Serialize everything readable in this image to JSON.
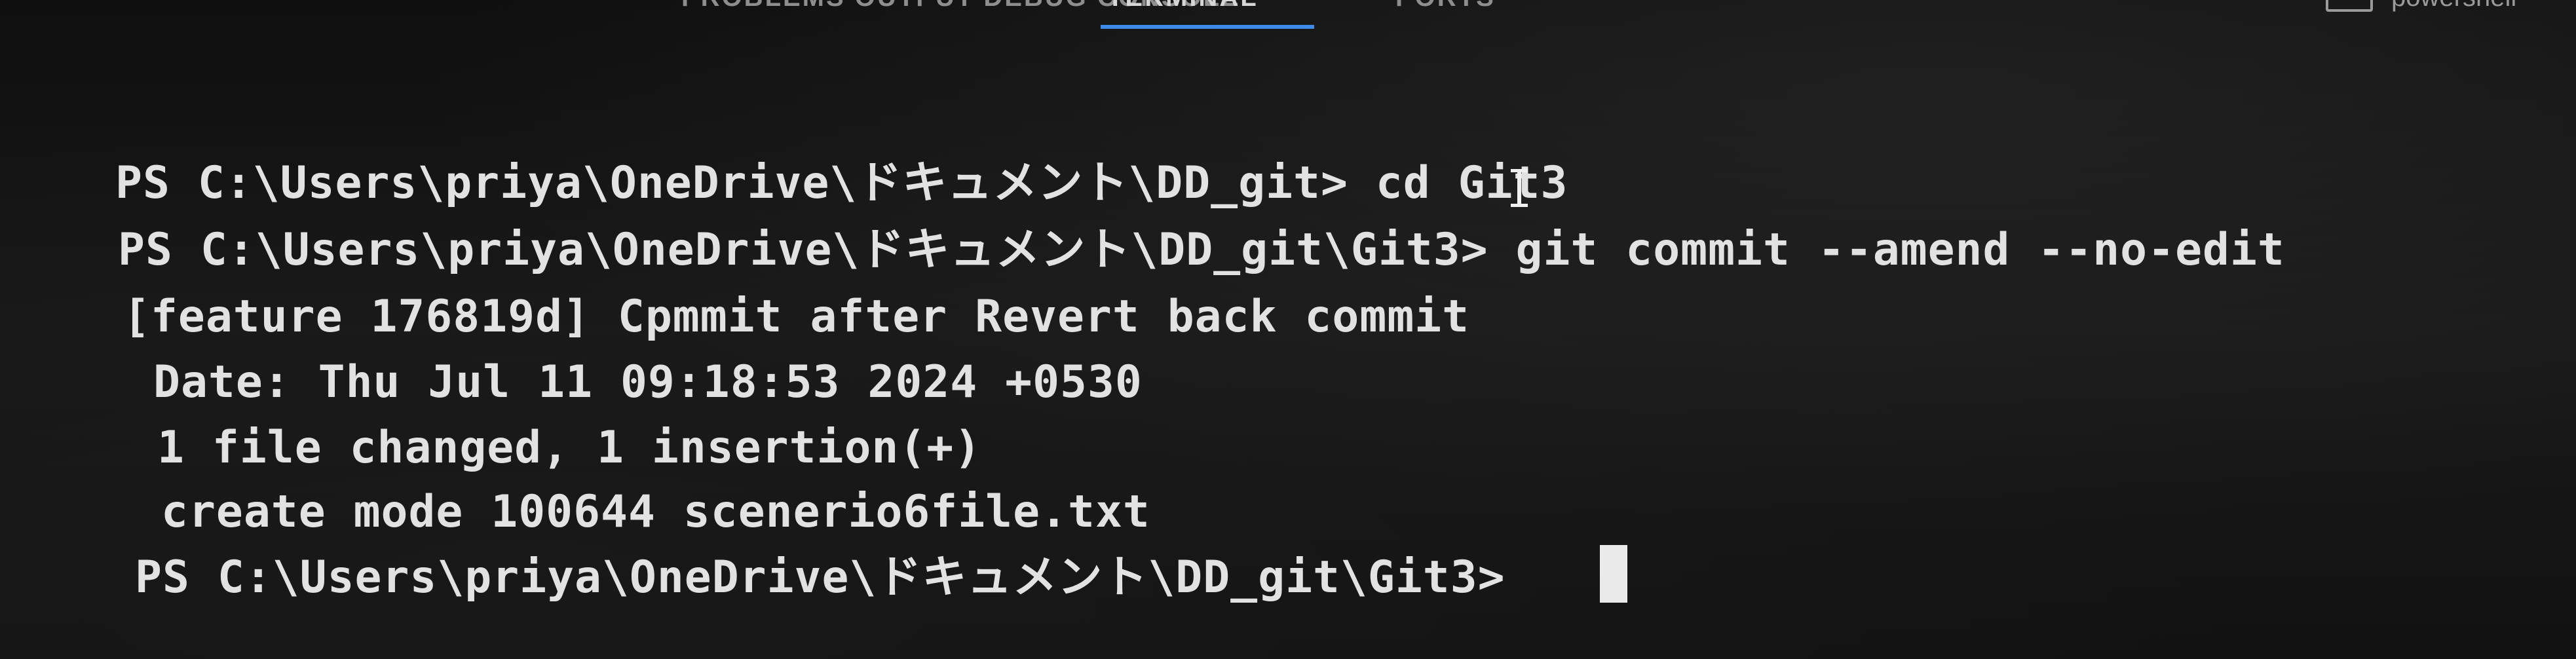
{
  "tabs": {
    "problems": "PROBLEMS OUTPUT DEBUG CONSOLE",
    "terminal": "TERMINAL",
    "ports": "PORTS"
  },
  "shell": {
    "label": "powershell",
    "icon": "terminal-icon"
  },
  "terminal": {
    "lines": [
      "PS C:\\Users\\priya\\OneDrive\\ドキュメント\\DD_git> cd Git3",
      "PS C:\\Users\\priya\\OneDrive\\ドキュメント\\DD_git\\Git3> git commit --amend --no-edit",
      "[feature 176819d] Cpmmit after Revert back commit",
      "Date: Thu Jul 11 09:18:53 2024 +0530",
      "1 file changed, 1 insertion(+)",
      "create mode 100644 scenerio6file.txt",
      "PS C:\\Users\\priya\\OneDrive\\ドキュメント\\DD_git\\Git3> "
    ]
  },
  "colors": {
    "background": "#141414",
    "text": "#e2e2e2",
    "active_tab_underline": "#3f8ae6",
    "cursor": "#eaeaea"
  }
}
